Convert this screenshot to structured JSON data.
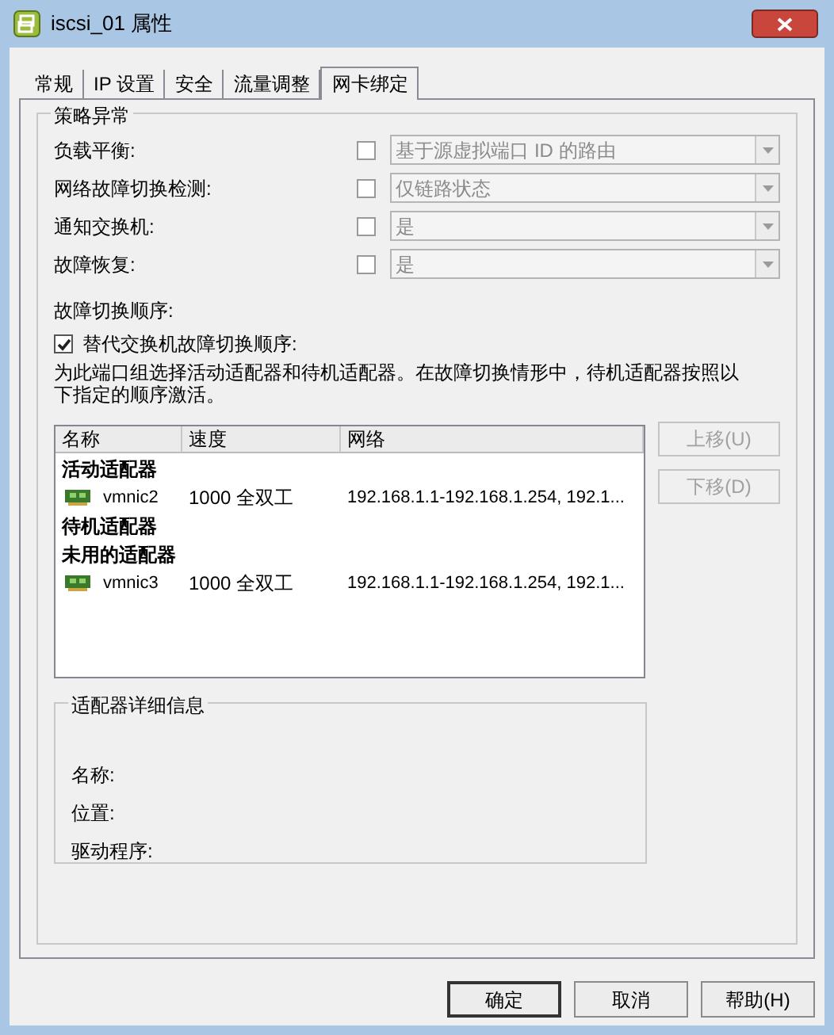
{
  "window": {
    "title": "iscsi_01 属性"
  },
  "tabs": [
    {
      "label": "常规",
      "selected": false
    },
    {
      "label": "IP 设置",
      "selected": false
    },
    {
      "label": "安全",
      "selected": false
    },
    {
      "label": "流量调整",
      "selected": false
    },
    {
      "label": "网卡绑定",
      "selected": true
    }
  ],
  "policy_exceptions": {
    "title": "策略异常",
    "rows": [
      {
        "label": "负载平衡:",
        "checked": false,
        "value": "基于源虚拟端口 ID 的路由",
        "disabled": true
      },
      {
        "label": "网络故障切换检测:",
        "checked": false,
        "value": "仅链路状态",
        "disabled": true
      },
      {
        "label": "通知交换机:",
        "checked": false,
        "value": "是",
        "disabled": true
      },
      {
        "label": "故障恢复:",
        "checked": false,
        "value": "是",
        "disabled": true
      }
    ]
  },
  "failover_order": {
    "label": "故障切换顺序:",
    "override": {
      "label": "替代交换机故障切换顺序:",
      "checked": true
    },
    "description": "为此端口组选择活动适配器和待机适配器。在故障切换情形中，待机适配器按照以下指定的顺序激活。"
  },
  "adapters": {
    "columns": [
      "名称",
      "速度",
      "网络"
    ],
    "rows": [
      {
        "kind": "group",
        "label": "活动适配器"
      },
      {
        "kind": "adapter",
        "name": "vmnic2",
        "speed": "1000 全双工",
        "network": "192.168.1.1-192.168.1.254, 192.1..."
      },
      {
        "kind": "group",
        "label": "待机适配器"
      },
      {
        "kind": "group",
        "label": "未用的适配器"
      },
      {
        "kind": "adapter",
        "name": "vmnic3",
        "speed": "1000 全双工",
        "network": "192.168.1.1-192.168.1.254, 192.1..."
      }
    ]
  },
  "move_buttons": [
    {
      "label": "上移(U)",
      "disabled": true
    },
    {
      "label": "下移(D)",
      "disabled": true
    }
  ],
  "adapter_details": {
    "title": "适配器详细信息",
    "fields": [
      "名称:",
      "位置:",
      "驱动程序:"
    ]
  },
  "buttons": [
    "确定",
    "取消",
    "帮助(H)"
  ]
}
